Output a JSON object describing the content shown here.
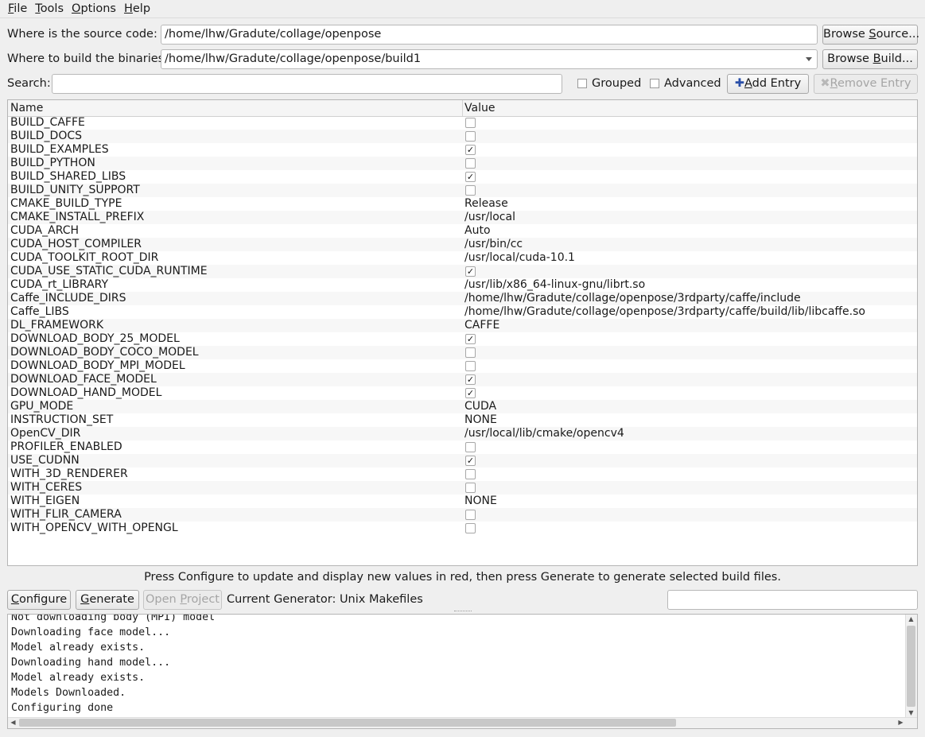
{
  "menubar": {
    "items": [
      {
        "mn": "F",
        "rest": "ile"
      },
      {
        "mn": "T",
        "rest": "ools"
      },
      {
        "mn": "O",
        "rest": "ptions"
      },
      {
        "mn": "H",
        "rest": "elp"
      }
    ]
  },
  "source": {
    "label": "Where is the source code:",
    "value": "/home/lhw/Gradute/collage/openpose",
    "button_pre": "Browse ",
    "button_mn": "S",
    "button_post": "ource..."
  },
  "build": {
    "label": "Where to build the binaries:",
    "value": "/home/lhw/Gradute/collage/openpose/build1",
    "button_pre": "Browse ",
    "button_mn": "B",
    "button_post": "uild..."
  },
  "search": {
    "label": "Search:",
    "value": "",
    "grouped_label": "Grouped",
    "advanced_label": "Advanced",
    "add_entry_mn": "A",
    "add_entry_post": "dd Entry",
    "remove_entry_mn": "R",
    "remove_entry_post": "emove Entry"
  },
  "table": {
    "col_name": "Name",
    "col_value": "Value",
    "rows": [
      {
        "name": "BUILD_CAFFE",
        "type": "bool",
        "checked": false
      },
      {
        "name": "BUILD_DOCS",
        "type": "bool",
        "checked": false
      },
      {
        "name": "BUILD_EXAMPLES",
        "type": "bool",
        "checked": true
      },
      {
        "name": "BUILD_PYTHON",
        "type": "bool",
        "checked": false
      },
      {
        "name": "BUILD_SHARED_LIBS",
        "type": "bool",
        "checked": true
      },
      {
        "name": "BUILD_UNITY_SUPPORT",
        "type": "bool",
        "checked": false
      },
      {
        "name": "CMAKE_BUILD_TYPE",
        "type": "text",
        "value": "Release"
      },
      {
        "name": "CMAKE_INSTALL_PREFIX",
        "type": "text",
        "value": "/usr/local"
      },
      {
        "name": "CUDA_ARCH",
        "type": "text",
        "value": "Auto"
      },
      {
        "name": "CUDA_HOST_COMPILER",
        "type": "text",
        "value": "/usr/bin/cc"
      },
      {
        "name": "CUDA_TOOLKIT_ROOT_DIR",
        "type": "text",
        "value": "/usr/local/cuda-10.1"
      },
      {
        "name": "CUDA_USE_STATIC_CUDA_RUNTIME",
        "type": "bool",
        "checked": true
      },
      {
        "name": "CUDA_rt_LIBRARY",
        "type": "text",
        "value": "/usr/lib/x86_64-linux-gnu/librt.so"
      },
      {
        "name": "Caffe_INCLUDE_DIRS",
        "type": "text",
        "value": "/home/lhw/Gradute/collage/openpose/3rdparty/caffe/include"
      },
      {
        "name": "Caffe_LIBS",
        "type": "text",
        "value": "/home/lhw/Gradute/collage/openpose/3rdparty/caffe/build/lib/libcaffe.so"
      },
      {
        "name": "DL_FRAMEWORK",
        "type": "text",
        "value": "CAFFE"
      },
      {
        "name": "DOWNLOAD_BODY_25_MODEL",
        "type": "bool",
        "checked": true
      },
      {
        "name": "DOWNLOAD_BODY_COCO_MODEL",
        "type": "bool",
        "checked": false
      },
      {
        "name": "DOWNLOAD_BODY_MPI_MODEL",
        "type": "bool",
        "checked": false
      },
      {
        "name": "DOWNLOAD_FACE_MODEL",
        "type": "bool",
        "checked": true
      },
      {
        "name": "DOWNLOAD_HAND_MODEL",
        "type": "bool",
        "checked": true
      },
      {
        "name": "GPU_MODE",
        "type": "text",
        "value": "CUDA"
      },
      {
        "name": "INSTRUCTION_SET",
        "type": "text",
        "value": "NONE"
      },
      {
        "name": "OpenCV_DIR",
        "type": "text",
        "value": "/usr/local/lib/cmake/opencv4"
      },
      {
        "name": "PROFILER_ENABLED",
        "type": "bool",
        "checked": false
      },
      {
        "name": "USE_CUDNN",
        "type": "bool",
        "checked": true
      },
      {
        "name": "WITH_3D_RENDERER",
        "type": "bool",
        "checked": false
      },
      {
        "name": "WITH_CERES",
        "type": "bool",
        "checked": false
      },
      {
        "name": "WITH_EIGEN",
        "type": "text",
        "value": "NONE"
      },
      {
        "name": "WITH_FLIR_CAMERA",
        "type": "bool",
        "checked": false
      },
      {
        "name": "WITH_OPENCV_WITH_OPENGL",
        "type": "bool",
        "checked": false
      }
    ]
  },
  "hint": "Press Configure to update and display new values in red, then press Generate to generate selected build files.",
  "actions": {
    "configure_mn": "C",
    "configure_post": "onfigure",
    "generate_mn": "G",
    "generate_post": "enerate",
    "open_project_pre": "Open ",
    "open_project_mn": "P",
    "open_project_post": "roject",
    "generator": "Current Generator: Unix Makefiles",
    "filter_value": ""
  },
  "output": {
    "lines": [
      "Not downloading body (MPI) model",
      "Downloading face model...",
      "Model already exists.",
      "Downloading hand model...",
      "Model already exists.",
      "Models Downloaded.",
      "Configuring done"
    ]
  }
}
